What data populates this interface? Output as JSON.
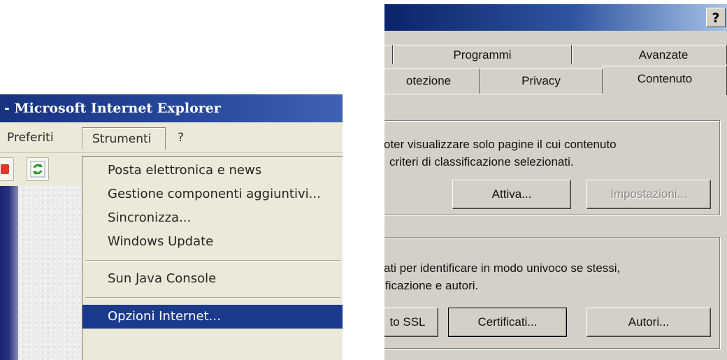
{
  "ie_window": {
    "title": "- Microsoft Internet Explorer",
    "menubar": {
      "preferiti": "Preferiti",
      "strumenti": "Strumenti",
      "help": "?"
    },
    "tools_menu": {
      "items": [
        "Posta elettronica e news",
        "Gestione componenti aggiuntivi...",
        "Sincronizza...",
        "Windows Update",
        "Sun Java Console",
        "Opzioni Internet..."
      ],
      "highlighted": "Opzioni Internet..."
    }
  },
  "options_dialog": {
    "help_button": "?",
    "tabs_back": {
      "programmi": "Programmi",
      "avanzate": "Avanzate"
    },
    "tabs_front": {
      "protezione": "otezione",
      "privacy": "Privacy",
      "contenuto": "Contenuto"
    },
    "active_tab": "Contenuto",
    "content_advisor": {
      "line1": "oter visualizzare solo pagine il cui contenuto",
      "line2": "criteri di classificazione selezionati.",
      "enable_button": "Attiva...",
      "settings_button": "Impostazioni..."
    },
    "certificates": {
      "line1": "ati per identificare in modo univoco se stessi,",
      "line2": "ficazione e autori.",
      "ssl_button": "to SSL",
      "certificates_button": "Certificati...",
      "publishers_button": "Autori..."
    }
  },
  "colors": {
    "ie_titlebar": "#27489a",
    "menu_highlight": "#1a3a8c",
    "dialog_face": "#d4d0c8",
    "dialog_titlebar": "#0a246a"
  }
}
